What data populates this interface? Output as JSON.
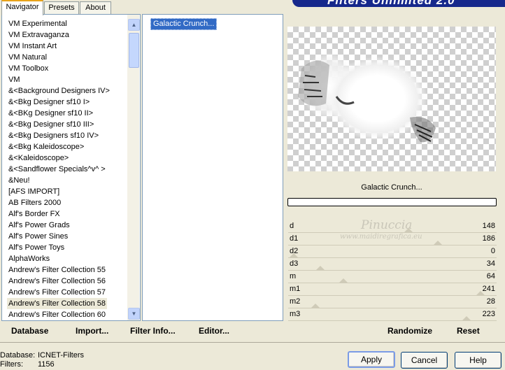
{
  "tabs": [
    {
      "label": "Navigator",
      "active": true
    },
    {
      "label": "Presets",
      "active": false
    },
    {
      "label": "About",
      "active": false
    }
  ],
  "banner": {
    "title": "Filters Unlimited 2.0"
  },
  "categories": [
    "VM Experimental",
    "VM Extravaganza",
    "VM Instant Art",
    "VM Natural",
    "VM Toolbox",
    "VM",
    "&<Background Designers IV>",
    "&<Bkg Designer sf10 I>",
    "&<BKg Designer sf10 II>",
    "&<Bkg Designer sf10 III>",
    "&<Bkg Designers sf10 IV>",
    "&<Bkg Kaleidoscope>",
    "&<Kaleidoscope>",
    "&<Sandflower Specials^v^ >",
    "&Neu!",
    "[AFS IMPORT]",
    "AB Filters 2000",
    "Alf's Border FX",
    "Alf's Power Grads",
    "Alf's Power Sines",
    "Alf's Power Toys",
    "AlphaWorks",
    "Andrew's Filter Collection 55",
    "Andrew's Filter Collection 56",
    "Andrew's Filter Collection 57",
    "Andrew's Filter Collection 58",
    "Andrew's Filter Collection 60"
  ],
  "selected_category": "Andrew's Filter Collection 58",
  "filters": [
    "Galactic Crunch..."
  ],
  "selected_filter": "Galactic Crunch...",
  "preview_label": "Galactic Crunch...",
  "watermark": {
    "line1": "Pinuccia",
    "line2": "www.maidiregrafica.eu"
  },
  "params": [
    {
      "name": "d",
      "value": 148
    },
    {
      "name": "d1",
      "value": 186
    },
    {
      "name": "d2",
      "value": 0
    },
    {
      "name": "d3",
      "value": 34
    },
    {
      "name": "m",
      "value": 64
    },
    {
      "name": "m1",
      "value": 241
    },
    {
      "name": "m2",
      "value": 28
    },
    {
      "name": "m3",
      "value": 223
    }
  ],
  "left_buttons": {
    "database": "Database",
    "import": "Import...",
    "filter_info": "Filter Info...",
    "editor": "Editor..."
  },
  "right_buttons": {
    "randomize": "Randomize",
    "reset": "Reset"
  },
  "dialog_buttons": {
    "apply": "Apply",
    "cancel": "Cancel",
    "help": "Help"
  },
  "status": {
    "database_label": "Database:",
    "database_value": "ICNET-Filters",
    "filters_label": "Filters:",
    "filters_value": "1156"
  },
  "colors": {
    "selection": "#316ac5",
    "banner": "#16288c",
    "tab_highlight": "#e8a31a"
  }
}
